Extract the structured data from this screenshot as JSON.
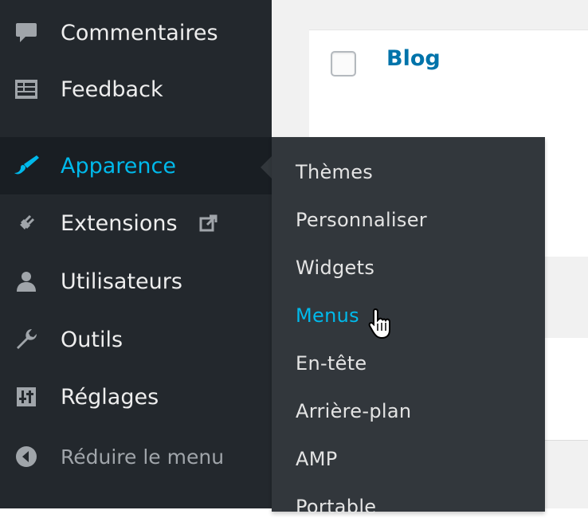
{
  "sidebar": {
    "items": [
      {
        "label": "Commentaires",
        "icon": "comment-icon"
      },
      {
        "label": "Feedback",
        "icon": "feedback-icon"
      },
      {
        "label": "Apparence",
        "icon": "paintbrush-icon"
      },
      {
        "label": "Extensions",
        "icon": "plugin-icon",
        "external_icon": "external-link-icon"
      },
      {
        "label": "Utilisateurs",
        "icon": "user-icon"
      },
      {
        "label": "Outils",
        "icon": "wrench-icon"
      },
      {
        "label": "Réglages",
        "icon": "settings-icon"
      },
      {
        "label": "Réduire le menu",
        "icon": "collapse-icon"
      }
    ]
  },
  "submenu": {
    "items": [
      {
        "label": "Thèmes"
      },
      {
        "label": "Personnaliser"
      },
      {
        "label": "Widgets"
      },
      {
        "label": "Menus"
      },
      {
        "label": "En-tête"
      },
      {
        "label": "Arrière-plan"
      },
      {
        "label": "AMP"
      },
      {
        "label": "Portable"
      }
    ]
  },
  "content": {
    "row_title": "Blog"
  },
  "colors": {
    "sidebar_bg": "#23282d",
    "submenu_bg": "#32373c",
    "active_accent": "#00b9eb",
    "link": "#0073aa"
  }
}
